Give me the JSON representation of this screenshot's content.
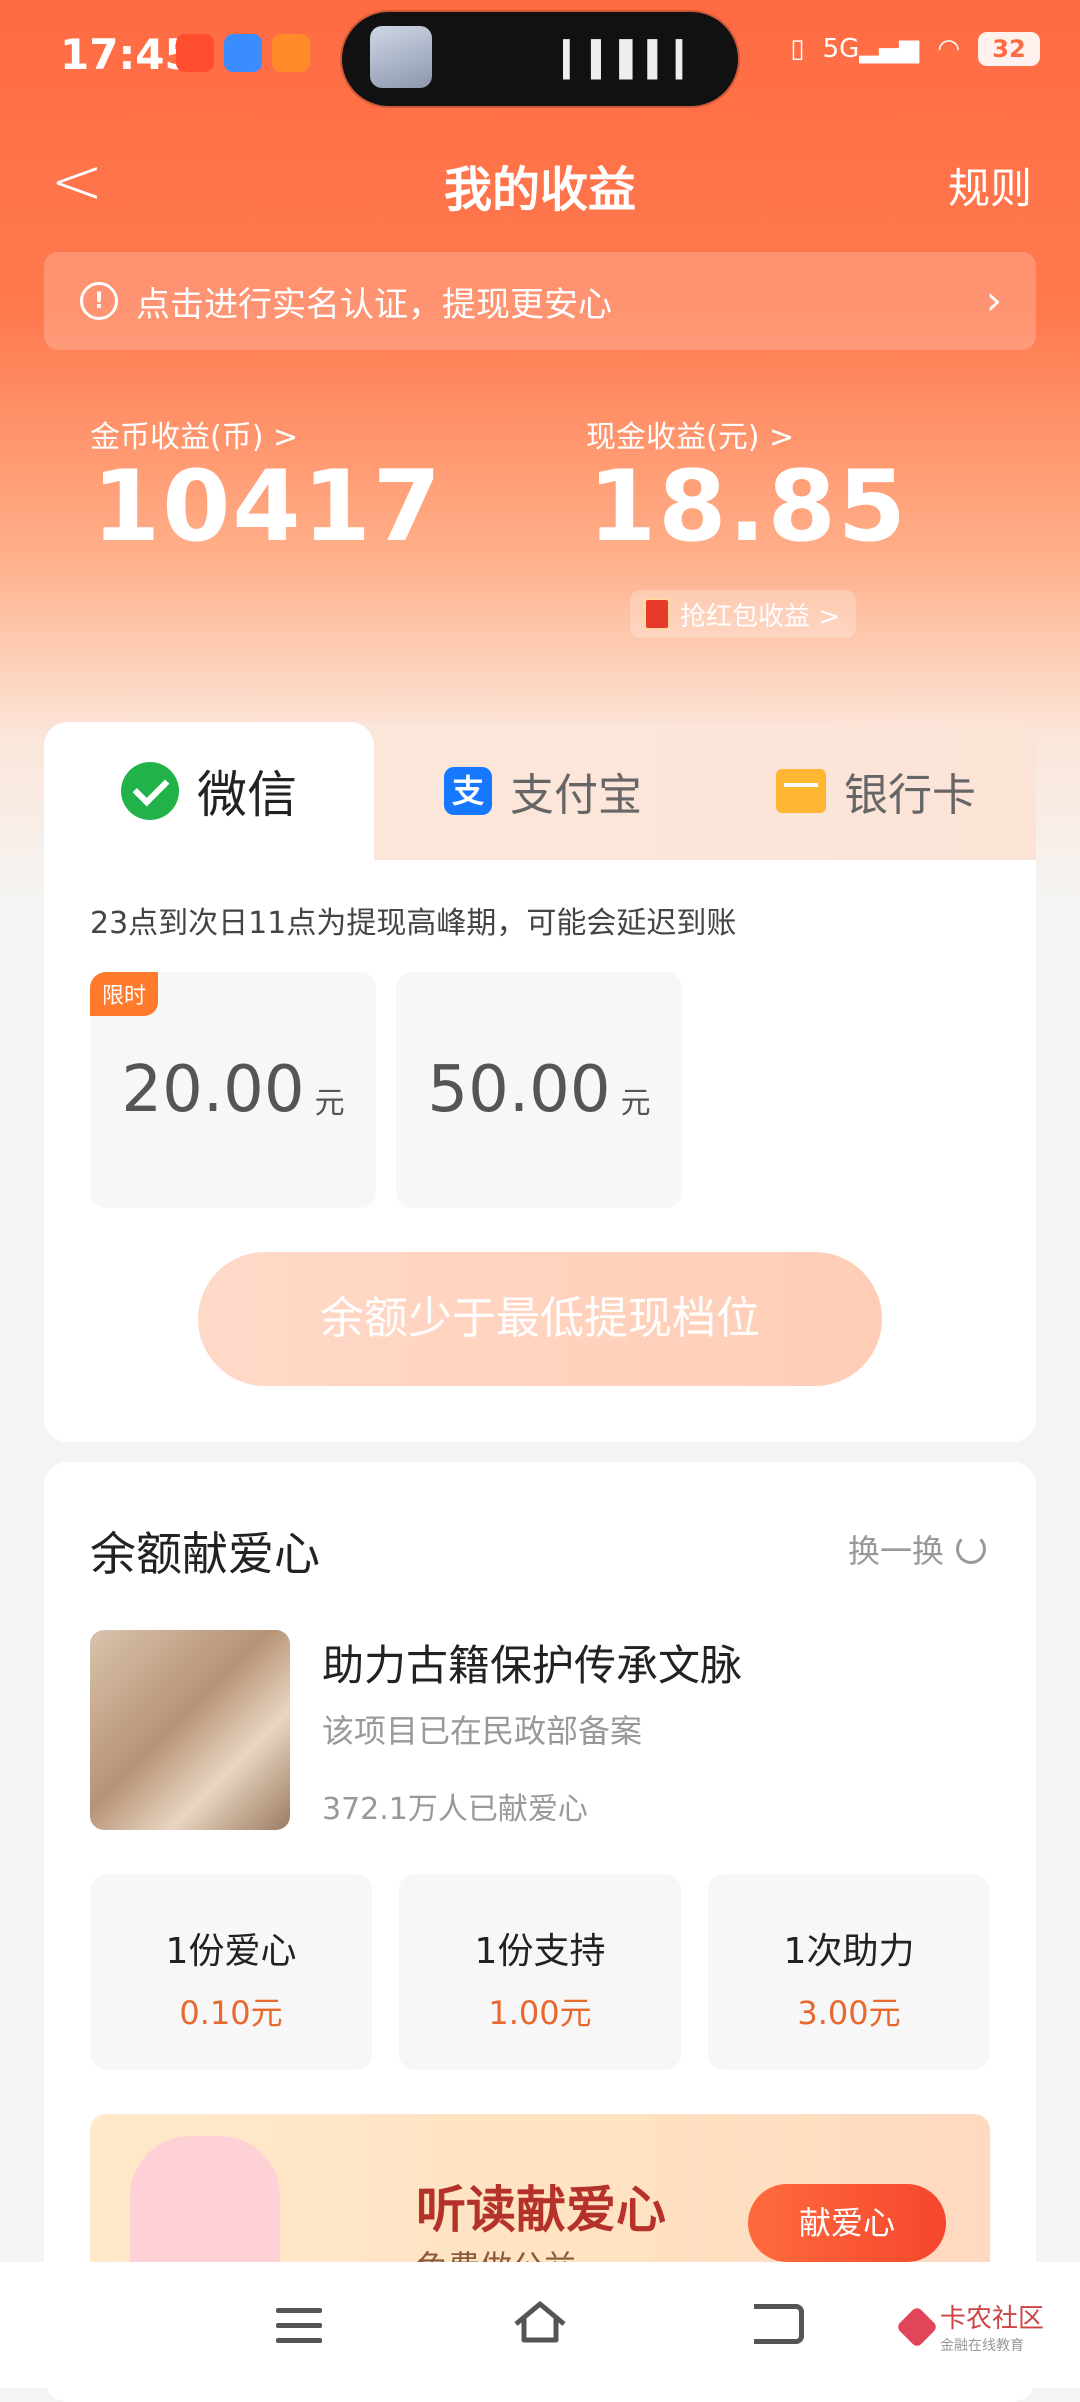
{
  "status_bar": {
    "time": "17:45",
    "network": "5G",
    "battery": "32"
  },
  "header": {
    "title": "我的收益",
    "back_label": "<",
    "rules_label": "规则"
  },
  "notice": {
    "text": "点击进行实名认证，提现更安心",
    "icon": "warning-icon"
  },
  "earnings": {
    "coin_label": "金币收益(币) >",
    "coin_value": "10417",
    "cash_label": "现金收益(元) >",
    "cash_value": "18.85",
    "red_packet_label": "抢红包收益 >"
  },
  "withdraw": {
    "tabs": [
      {
        "label": "微信",
        "icon": "wechat-icon",
        "active": true
      },
      {
        "label": "支付宝",
        "icon": "alipay-icon",
        "active": false
      },
      {
        "label": "银行卡",
        "icon": "bank-card-icon",
        "active": false
      }
    ],
    "hint": "23点到次日11点为提现高峰期，可能会延迟到账",
    "amounts": [
      {
        "value": "20.00",
        "unit": "元",
        "badge": "限时"
      },
      {
        "value": "50.00",
        "unit": "元",
        "badge": ""
      }
    ],
    "button_label": "余额少于最低提现档位"
  },
  "charity": {
    "title": "余额献爱心",
    "refresh_label": "换一换",
    "project": {
      "title": "助力古籍保护传承文脉",
      "subtitle": "该项目已在民政部备案",
      "count": "372.1万人已献爱心"
    },
    "options": [
      {
        "label": "1份爱心",
        "price": "0.10元"
      },
      {
        "label": "1份支持",
        "price": "1.00元"
      },
      {
        "label": "1次助力",
        "price": "3.00元"
      }
    ],
    "banner": {
      "title": "听读献爱心",
      "subtitle": "免费做公益",
      "button": "献爱心"
    }
  },
  "nav": {
    "watermark": "卡农社区",
    "watermark_sub": "金融在线教育"
  },
  "colors": {
    "accent": "#ff6b43",
    "price": "#e8692e",
    "wechat": "#21b34a",
    "alipay": "#1677ff"
  }
}
